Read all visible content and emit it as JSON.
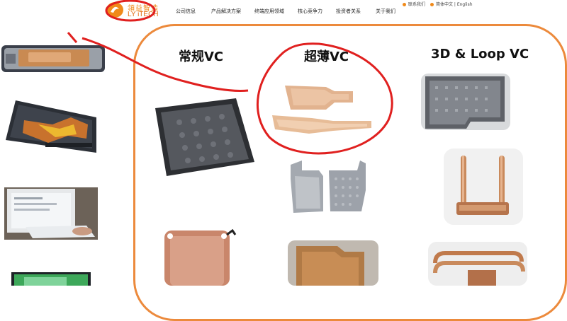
{
  "header": {
    "logo_cn": "領益智造",
    "logo_en": "LY iTECH",
    "nav": [
      "公司信息",
      "产品解决方案",
      "终端应用领域",
      "核心竞争力",
      "投资者关系",
      "关于我们"
    ],
    "contact": "联系我们",
    "language": "简体中文 | English"
  },
  "colors": {
    "brand_orange": "#f08a1a",
    "panel_border": "#ec8a3c",
    "annotation_red": "#e0201f"
  },
  "columns": [
    {
      "title": "常规VC"
    },
    {
      "title": "超薄VC"
    },
    {
      "title": "3D & Loop VC"
    }
  ],
  "icons": [
    "logo-icon",
    "contact-icon",
    "language-icon"
  ]
}
